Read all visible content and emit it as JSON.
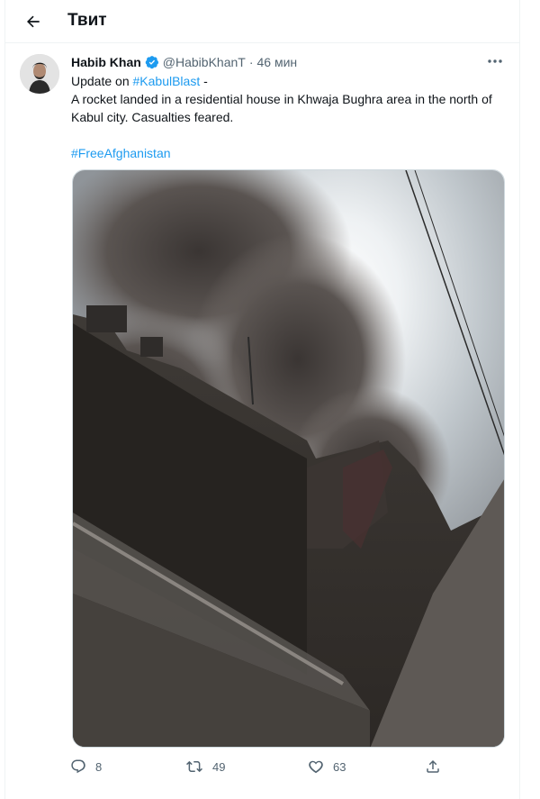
{
  "header": {
    "title": "Твит"
  },
  "tweet": {
    "author_name": "Habib Khan",
    "handle": "@HabibKhanT",
    "separator": "·",
    "time": "46 мин",
    "line1_prefix": "Update on ",
    "line1_hashtag": "#KabulBlast",
    "line1_suffix": " -",
    "body": "A rocket landed in a residential house in Khwaja Bughra area in the north of Kabul city. Casualties feared.",
    "hashtag": "#FreeAfghanistan"
  },
  "actions": {
    "replies": "8",
    "retweets": "49",
    "likes": "63"
  },
  "icons": {
    "back": "arrow-left-icon",
    "verified": "verified-badge-icon",
    "more": "more-dots-icon",
    "reply": "reply-icon",
    "retweet": "retweet-icon",
    "like": "heart-icon",
    "share": "share-icon"
  },
  "colors": {
    "accent": "#1d9bf0",
    "text": "#0f1419",
    "muted": "#536471"
  }
}
